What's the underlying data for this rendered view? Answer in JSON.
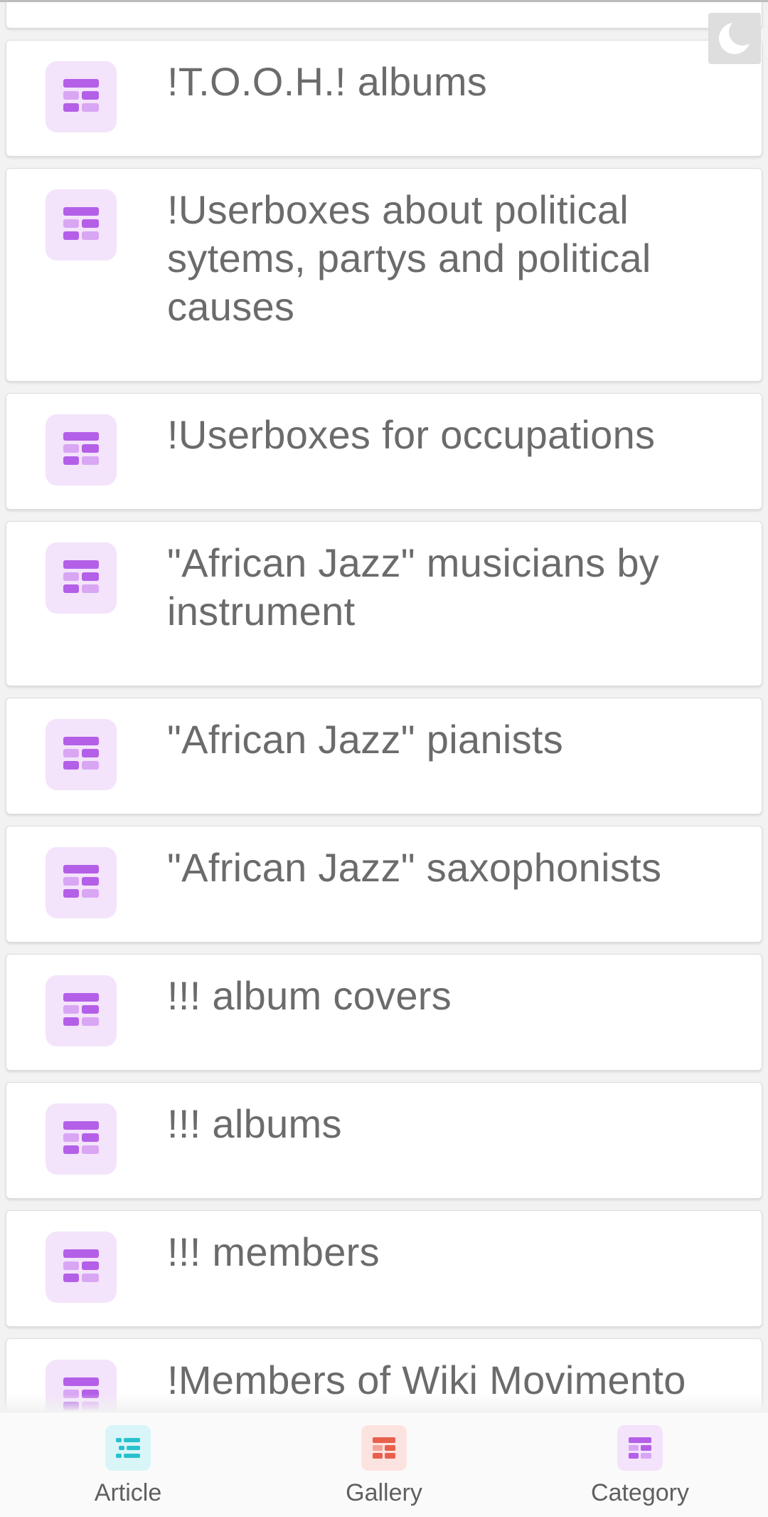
{
  "list": {
    "items": [
      {
        "label": "!T.O.O.H.! albums"
      },
      {
        "label": "!Userboxes about political sytems, partys and political causes"
      },
      {
        "label": "!Userboxes for occupations"
      },
      {
        "label": "\"African Jazz\" musicians by instrument"
      },
      {
        "label": "\"African Jazz\" pianists"
      },
      {
        "label": "\"African Jazz\" saxophonists"
      },
      {
        "label": "!!! album covers"
      },
      {
        "label": "!!! albums"
      },
      {
        "label": "!!! members"
      },
      {
        "label": "!Members of Wiki Movimento"
      }
    ],
    "item_icon": "category-grid-icon"
  },
  "night_mode": {
    "icon": "moon-icon"
  },
  "bottom_nav": {
    "items": [
      {
        "label": "Article",
        "icon": "article-list-icon",
        "tile_color": "#d9f5f7",
        "glyph_color": "#28c2cc"
      },
      {
        "label": "Gallery",
        "icon": "gallery-grid-icon",
        "tile_color": "#fde3e0",
        "glyph_color": "#e8604c"
      },
      {
        "label": "Category",
        "icon": "category-grid-icon",
        "tile_color": "#f3e3fb",
        "glyph_color": "#b45fe8"
      }
    ]
  },
  "colors": {
    "category_accent": "#b45fe8",
    "category_tile_bg": "#f3e3fb",
    "text": "#6b6b6b",
    "background": "#f2f2f2"
  }
}
